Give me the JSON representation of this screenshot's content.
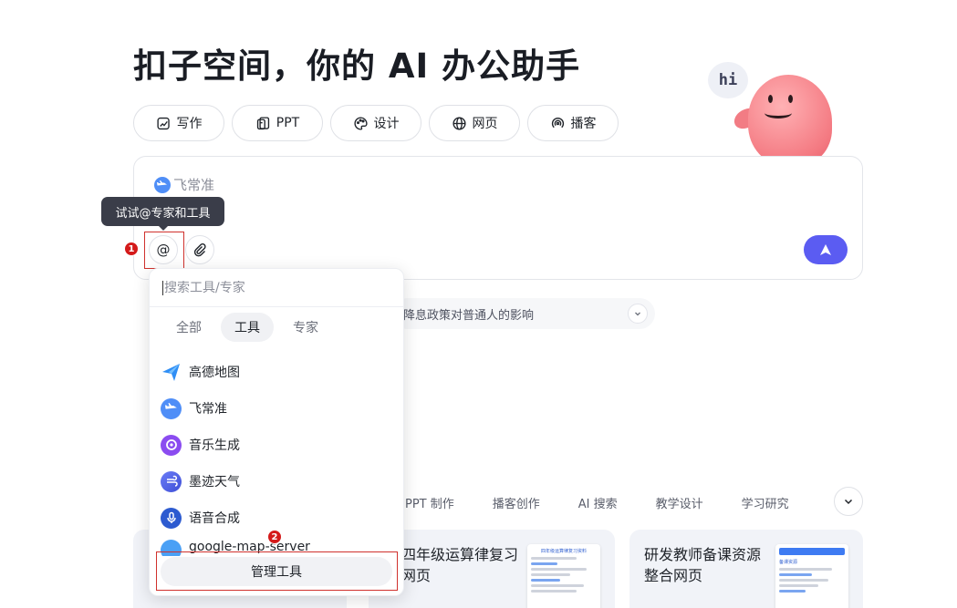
{
  "page": {
    "title": "扣子空间，你的 AI 办公助手",
    "mascot_bubble": "hi"
  },
  "chips": [
    {
      "label": "写作",
      "icon": "pen-image-icon"
    },
    {
      "label": "PPT",
      "icon": "ppt-icon"
    },
    {
      "label": "设计",
      "icon": "palette-icon"
    },
    {
      "label": "网页",
      "icon": "globe-icon"
    },
    {
      "label": "播客",
      "icon": "podcast-icon"
    }
  ],
  "input": {
    "selected_tool": "飞常准",
    "tooltip": "试试@专家和工具",
    "at_icon": "@"
  },
  "suggestion": {
    "text": "降息政策对普通人的影响"
  },
  "dropdown": {
    "search_placeholder": "搜索工具/专家",
    "tabs": [
      "全部",
      "工具",
      "专家"
    ],
    "active_tab": "工具",
    "tools": [
      {
        "label": "高德地图",
        "icon": "amap-icon",
        "color": "#2f8ef5"
      },
      {
        "label": "飞常准",
        "icon": "plane-icon",
        "color": "#4f8ef7"
      },
      {
        "label": "音乐生成",
        "icon": "music-icon",
        "color": "#8b4cf0"
      },
      {
        "label": "墨迹天气",
        "icon": "weather-icon",
        "color": "#5a6df2"
      },
      {
        "label": "语音合成",
        "icon": "microphone-icon",
        "color": "#2d5bd0"
      },
      {
        "label": "google-map-server",
        "icon": "map-server-icon",
        "color": "#4aa0f5"
      }
    ],
    "manage_label": "管理工具"
  },
  "markers": [
    "1",
    "2"
  ],
  "categories": [
    "PPT 制作",
    "播客创作",
    "AI 搜索",
    "教学设计",
    "学习研究"
  ],
  "cards": [
    {
      "title": "四年级运算律复习网页",
      "thumb_title": "四年级运算律复习资料"
    },
    {
      "title": "研发教师备课资源整合网页",
      "thumb_title": "备课资源"
    }
  ],
  "colors": {
    "accent": "#5b5cf2",
    "highlight": "#d0312d",
    "marker": "#d41a1a"
  }
}
